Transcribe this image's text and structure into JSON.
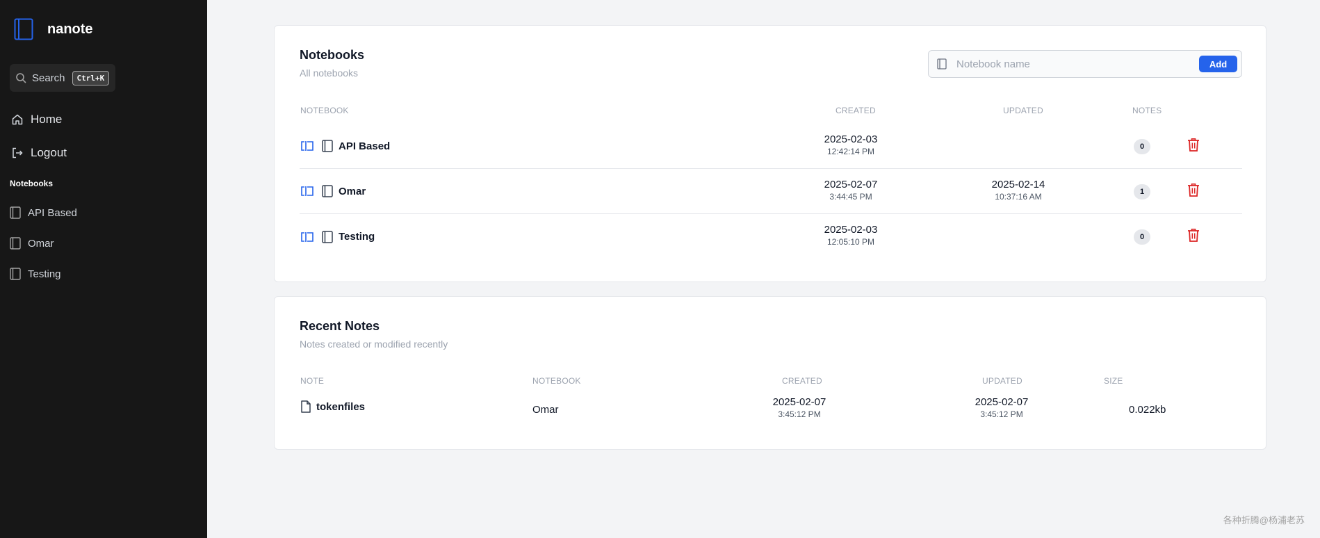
{
  "app": {
    "name": "nanote"
  },
  "sidebar": {
    "search_label": "Search",
    "search_shortcut": "Ctrl+K",
    "nav": [
      {
        "label": "Home",
        "icon": "home-icon"
      },
      {
        "label": "Logout",
        "icon": "logout-icon"
      }
    ],
    "notebooks_heading": "Notebooks",
    "notebooks": [
      {
        "label": "API Based",
        "icon": "notebook-icon"
      },
      {
        "label": "Omar",
        "icon": "notebook-icon"
      },
      {
        "label": "Testing",
        "icon": "notebook-icon"
      }
    ]
  },
  "notebooks_card": {
    "title": "Notebooks",
    "subtitle": "All notebooks",
    "input_placeholder": "Notebook name",
    "add_label": "Add",
    "headers": {
      "notebook": "NOTEBOOK",
      "created": "CREATED",
      "updated": "UPDATED",
      "notes": "NOTES"
    },
    "rows": [
      {
        "name": "API Based",
        "created_date": "2025-02-03",
        "created_time": "12:42:14 PM",
        "updated_date": "",
        "updated_time": "",
        "notes": "0"
      },
      {
        "name": "Omar",
        "created_date": "2025-02-07",
        "created_time": "3:44:45 PM",
        "updated_date": "2025-02-14",
        "updated_time": "10:37:16 AM",
        "notes": "1"
      },
      {
        "name": "Testing",
        "created_date": "2025-02-03",
        "created_time": "12:05:10 PM",
        "updated_date": "",
        "updated_time": "",
        "notes": "0"
      }
    ]
  },
  "recent_card": {
    "title": "Recent Notes",
    "subtitle": "Notes created or modified recently",
    "headers": {
      "note": "NOTE",
      "notebook": "NOTEBOOK",
      "created": "CREATED",
      "updated": "UPDATED",
      "size": "SIZE"
    },
    "rows": [
      {
        "note": "tokenfiles",
        "notebook": "Omar",
        "created_date": "2025-02-07",
        "created_time": "3:45:12 PM",
        "updated_date": "2025-02-07",
        "updated_time": "3:45:12 PM",
        "size": "0.022kb"
      }
    ]
  },
  "watermark": "各种折腾@杨浦老苏",
  "colors": {
    "sidebar_bg": "#171717",
    "accent": "#2563eb",
    "danger": "#dc2626",
    "page_bg": "#f3f4f6"
  }
}
